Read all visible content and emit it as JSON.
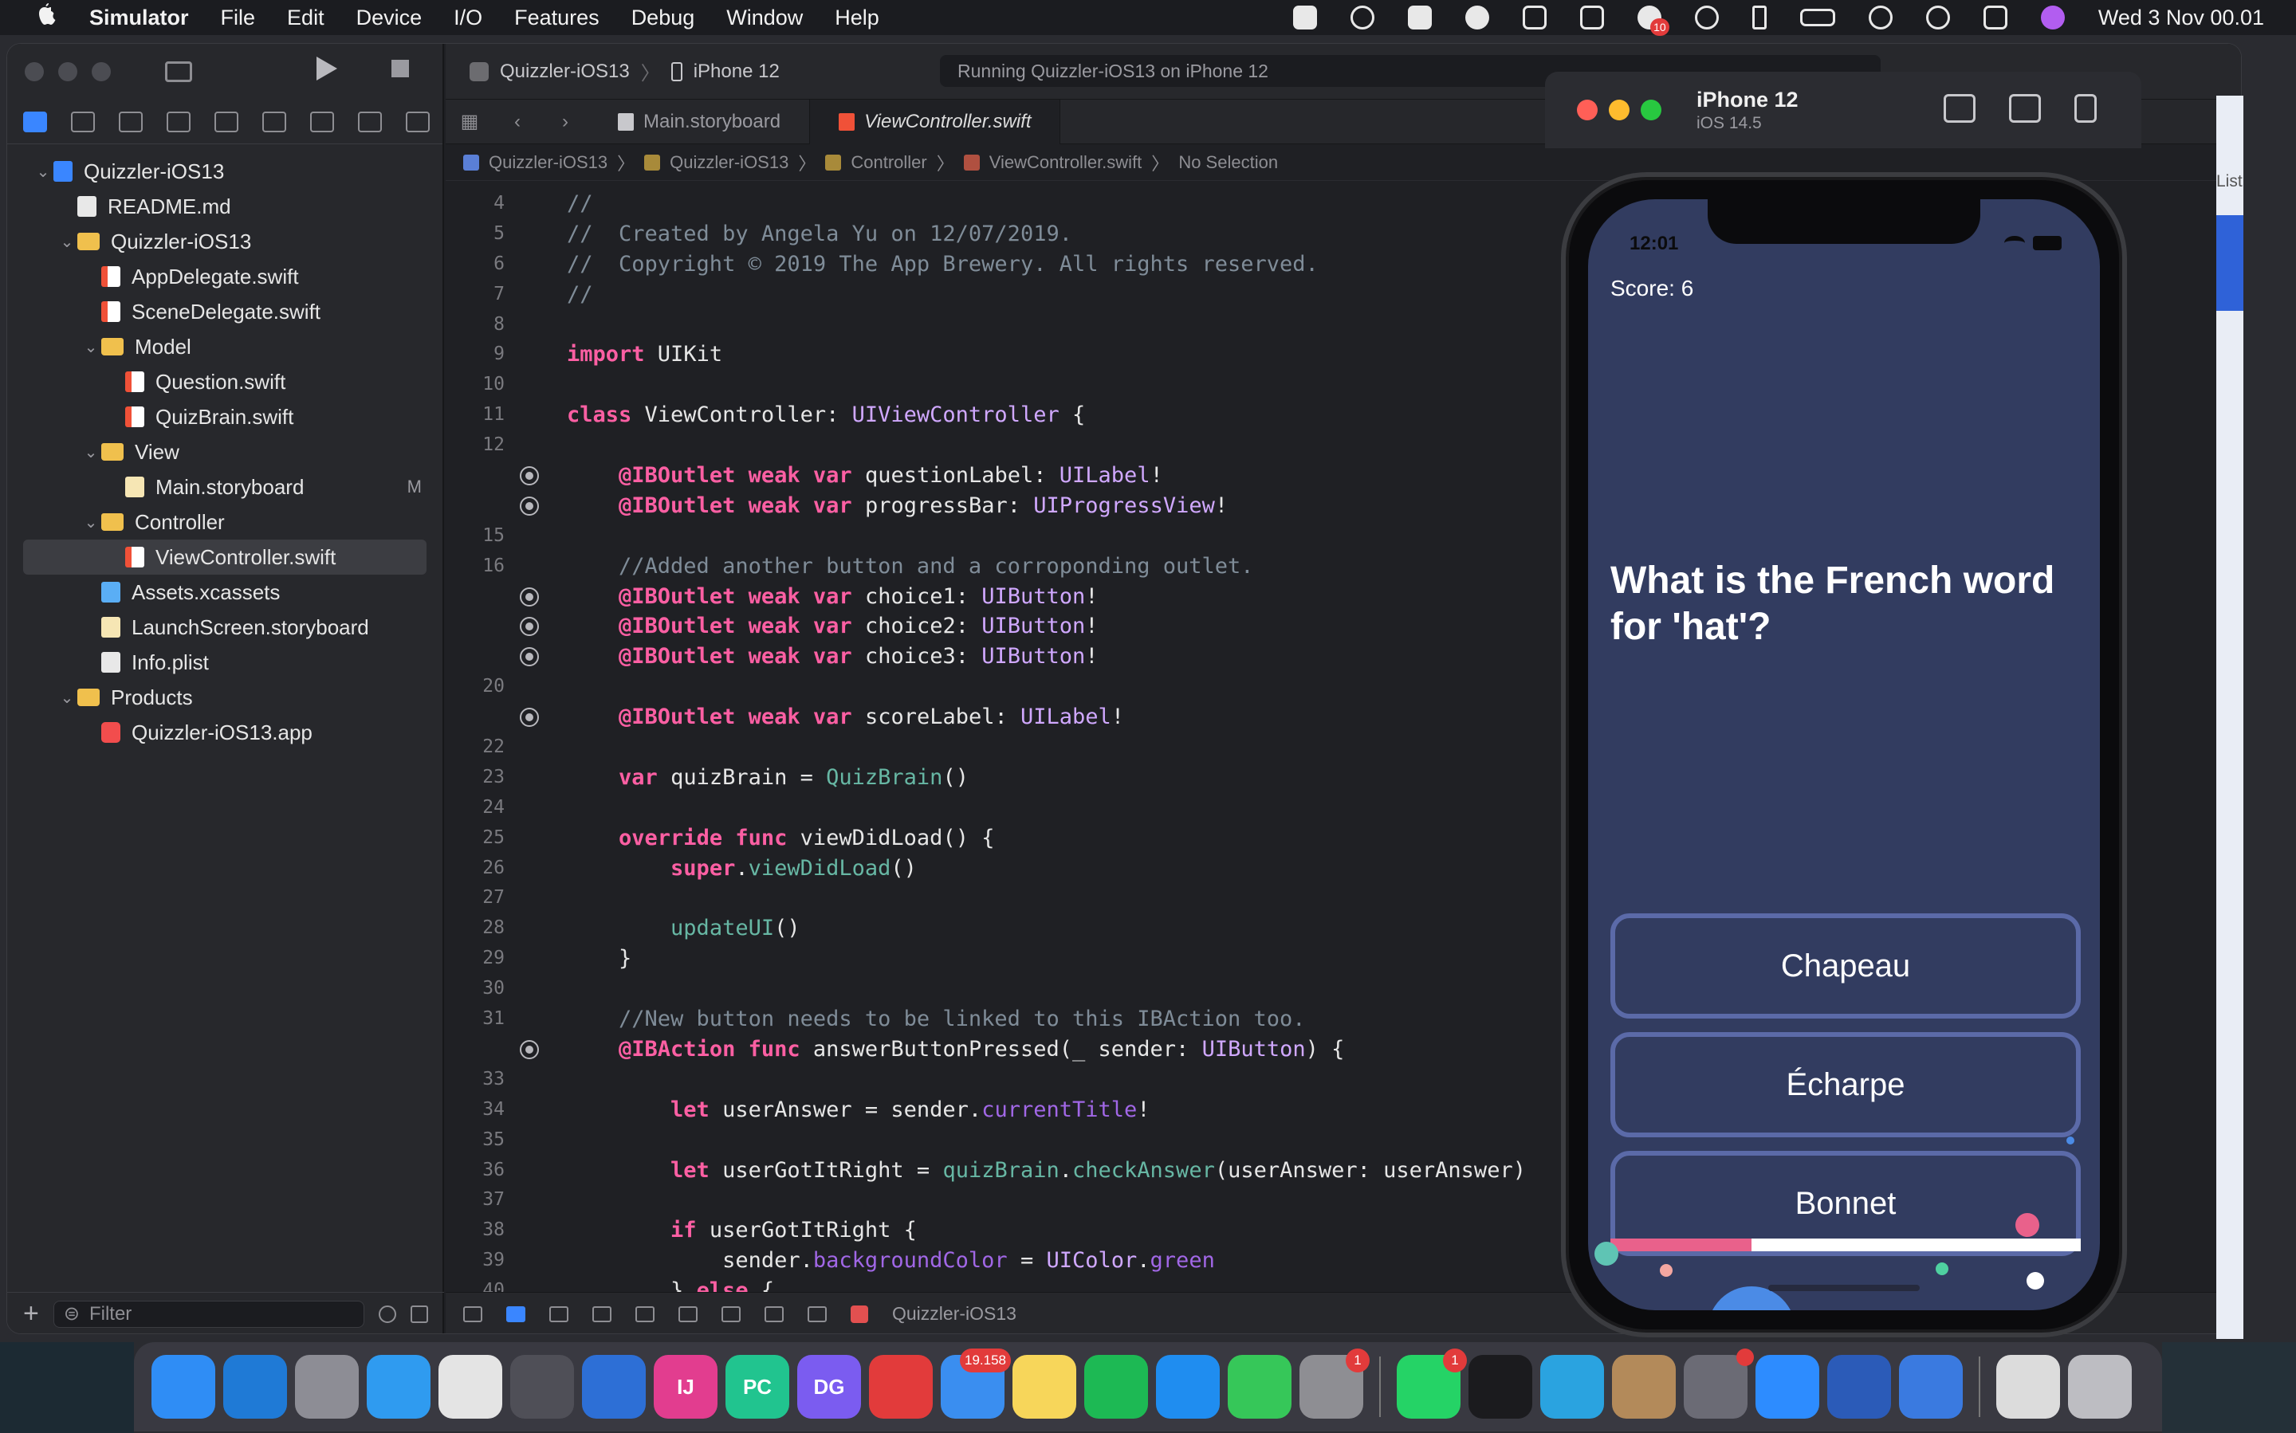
{
  "menubar": {
    "apple_icon": "apple-icon",
    "app_name": "Simulator",
    "items": [
      "File",
      "Edit",
      "Device",
      "I/O",
      "Features",
      "Debug",
      "Window",
      "Help"
    ],
    "status_icons": [
      "screen-record-icon",
      "target-icon",
      "feather-icon",
      "cloud-icon",
      "scribble-icon",
      "dropbox-icon",
      "notification-icon",
      "play-circle-icon",
      "bluetooth-icon",
      "battery-icon",
      "wifi-icon",
      "search-icon",
      "control-center-icon",
      "siri-icon"
    ],
    "notification_badge": "10",
    "clock": "Wed 3 Nov  00.01"
  },
  "xcode": {
    "scheme": "Quizzler-iOS13",
    "device": "iPhone 12",
    "activity": "Running Quizzler-iOS13 on iPhone 12",
    "tabs": [
      {
        "label": "Main.storyboard",
        "active": false
      },
      {
        "label": "ViewController.swift",
        "active": true
      }
    ],
    "jumpbar": [
      "Quizzler-iOS13",
      "Quizzler-iOS13",
      "Controller",
      "ViewController.swift",
      "No Selection"
    ],
    "navigator": [
      {
        "label": "Quizzler-iOS13",
        "icon": "proj",
        "indent": 0,
        "chevron": "open"
      },
      {
        "label": "README.md",
        "icon": "doc",
        "indent": 1,
        "chevron": ""
      },
      {
        "label": "Quizzler-iOS13",
        "icon": "folder",
        "indent": 1,
        "chevron": "open"
      },
      {
        "label": "AppDelegate.swift",
        "icon": "swift",
        "indent": 2,
        "chevron": ""
      },
      {
        "label": "SceneDelegate.swift",
        "icon": "swift",
        "indent": 2,
        "chevron": ""
      },
      {
        "label": "Model",
        "icon": "folder",
        "indent": 2,
        "chevron": "open"
      },
      {
        "label": "Question.swift",
        "icon": "swift",
        "indent": 3,
        "chevron": ""
      },
      {
        "label": "QuizBrain.swift",
        "icon": "swift",
        "indent": 3,
        "chevron": ""
      },
      {
        "label": "View",
        "icon": "folder",
        "indent": 2,
        "chevron": "open"
      },
      {
        "label": "Main.storyboard",
        "icon": "sb",
        "indent": 3,
        "chevron": "",
        "mark": "M"
      },
      {
        "label": "Controller",
        "icon": "folder",
        "indent": 2,
        "chevron": "open"
      },
      {
        "label": "ViewController.swift",
        "icon": "swift",
        "indent": 3,
        "chevron": "",
        "selected": true
      },
      {
        "label": "Assets.xcassets",
        "icon": "assets",
        "indent": 2,
        "chevron": ""
      },
      {
        "label": "LaunchScreen.storyboard",
        "icon": "sb",
        "indent": 2,
        "chevron": ""
      },
      {
        "label": "Info.plist",
        "icon": "doc",
        "indent": 2,
        "chevron": ""
      },
      {
        "label": "Products",
        "icon": "folder",
        "indent": 1,
        "chevron": "open"
      },
      {
        "label": "Quizzler-iOS13.app",
        "icon": "app",
        "indent": 2,
        "chevron": ""
      }
    ],
    "filter_placeholder": "Filter",
    "bottom_scheme": "Quizzler-iOS13",
    "inspector_label": "List",
    "code_lines": [
      {
        "n": "4",
        "bp": false,
        "parts": [
          [
            "c",
            "//"
          ]
        ]
      },
      {
        "n": "5",
        "bp": false,
        "parts": [
          [
            "c",
            "//  Created by Angela Yu on 12/07/2019."
          ]
        ]
      },
      {
        "n": "6",
        "bp": false,
        "parts": [
          [
            "c",
            "//  Copyright © 2019 The App Brewery. All rights reserved."
          ]
        ]
      },
      {
        "n": "7",
        "bp": false,
        "parts": [
          [
            "c",
            "//"
          ]
        ]
      },
      {
        "n": "8",
        "bp": false,
        "parts": []
      },
      {
        "n": "9",
        "bp": false,
        "parts": [
          [
            "k",
            "import"
          ],
          [
            "v",
            " UIKit"
          ]
        ]
      },
      {
        "n": "10",
        "bp": false,
        "parts": []
      },
      {
        "n": "11",
        "bp": false,
        "parts": [
          [
            "k",
            "class"
          ],
          [
            "v",
            " ViewController: "
          ],
          [
            "t",
            "UIViewController"
          ],
          [
            "v",
            " {"
          ]
        ]
      },
      {
        "n": "12",
        "bp": false,
        "parts": []
      },
      {
        "n": "",
        "bp": true,
        "parts": [
          [
            "v",
            "    "
          ],
          [
            "k",
            "@IBOutlet"
          ],
          [
            "v",
            " "
          ],
          [
            "k",
            "weak"
          ],
          [
            "v",
            " "
          ],
          [
            "k",
            "var"
          ],
          [
            "v",
            " questionLabel: "
          ],
          [
            "t",
            "UILabel"
          ],
          [
            "v",
            "!"
          ]
        ]
      },
      {
        "n": "",
        "bp": true,
        "parts": [
          [
            "v",
            "    "
          ],
          [
            "k",
            "@IBOutlet"
          ],
          [
            "v",
            " "
          ],
          [
            "k",
            "weak"
          ],
          [
            "v",
            " "
          ],
          [
            "k",
            "var"
          ],
          [
            "v",
            " progressBar: "
          ],
          [
            "t",
            "UIProgressView"
          ],
          [
            "v",
            "!"
          ]
        ]
      },
      {
        "n": "15",
        "bp": false,
        "parts": []
      },
      {
        "n": "16",
        "bp": false,
        "parts": [
          [
            "c",
            "    //Added another button and a corroponding outlet."
          ]
        ]
      },
      {
        "n": "",
        "bp": true,
        "parts": [
          [
            "v",
            "    "
          ],
          [
            "k",
            "@IBOutlet"
          ],
          [
            "v",
            " "
          ],
          [
            "k",
            "weak"
          ],
          [
            "v",
            " "
          ],
          [
            "k",
            "var"
          ],
          [
            "v",
            " choice1: "
          ],
          [
            "t",
            "UIButton"
          ],
          [
            "v",
            "!"
          ]
        ]
      },
      {
        "n": "",
        "bp": true,
        "parts": [
          [
            "v",
            "    "
          ],
          [
            "k",
            "@IBOutlet"
          ],
          [
            "v",
            " "
          ],
          [
            "k",
            "weak"
          ],
          [
            "v",
            " "
          ],
          [
            "k",
            "var"
          ],
          [
            "v",
            " choice2: "
          ],
          [
            "t",
            "UIButton"
          ],
          [
            "v",
            "!"
          ]
        ]
      },
      {
        "n": "",
        "bp": true,
        "parts": [
          [
            "v",
            "    "
          ],
          [
            "k",
            "@IBOutlet"
          ],
          [
            "v",
            " "
          ],
          [
            "k",
            "weak"
          ],
          [
            "v",
            " "
          ],
          [
            "k",
            "var"
          ],
          [
            "v",
            " choice3: "
          ],
          [
            "t",
            "UIButton"
          ],
          [
            "v",
            "!"
          ]
        ]
      },
      {
        "n": "20",
        "bp": false,
        "parts": []
      },
      {
        "n": "",
        "bp": true,
        "parts": [
          [
            "v",
            "    "
          ],
          [
            "k",
            "@IBOutlet"
          ],
          [
            "v",
            " "
          ],
          [
            "k",
            "weak"
          ],
          [
            "v",
            " "
          ],
          [
            "k",
            "var"
          ],
          [
            "v",
            " scoreLabel: "
          ],
          [
            "t",
            "UILabel"
          ],
          [
            "v",
            "!"
          ]
        ]
      },
      {
        "n": "22",
        "bp": false,
        "parts": []
      },
      {
        "n": "23",
        "bp": false,
        "parts": [
          [
            "v",
            "    "
          ],
          [
            "k",
            "var"
          ],
          [
            "v",
            " quizBrain = "
          ],
          [
            "f",
            "QuizBrain"
          ],
          [
            "v",
            "()"
          ]
        ]
      },
      {
        "n": "24",
        "bp": false,
        "parts": []
      },
      {
        "n": "25",
        "bp": false,
        "parts": [
          [
            "v",
            "    "
          ],
          [
            "k",
            "override"
          ],
          [
            "v",
            " "
          ],
          [
            "k",
            "func"
          ],
          [
            "v",
            " viewDidLoad() {"
          ]
        ]
      },
      {
        "n": "26",
        "bp": false,
        "parts": [
          [
            "v",
            "        "
          ],
          [
            "k",
            "super"
          ],
          [
            "v",
            "."
          ],
          [
            "f",
            "viewDidLoad"
          ],
          [
            "v",
            "()"
          ]
        ]
      },
      {
        "n": "27",
        "bp": false,
        "parts": []
      },
      {
        "n": "28",
        "bp": false,
        "parts": [
          [
            "v",
            "        "
          ],
          [
            "f",
            "updateUI"
          ],
          [
            "v",
            "()"
          ]
        ]
      },
      {
        "n": "29",
        "bp": false,
        "parts": [
          [
            "v",
            "    }"
          ]
        ]
      },
      {
        "n": "30",
        "bp": false,
        "parts": []
      },
      {
        "n": "31",
        "bp": false,
        "parts": [
          [
            "c",
            "    //New button needs to be linked to this IBAction too."
          ]
        ]
      },
      {
        "n": "",
        "bp": true,
        "parts": [
          [
            "v",
            "    "
          ],
          [
            "k",
            "@IBAction"
          ],
          [
            "v",
            " "
          ],
          [
            "k",
            "func"
          ],
          [
            "v",
            " answerButtonPressed(_ sender: "
          ],
          [
            "t",
            "UIButton"
          ],
          [
            "v",
            ") {"
          ]
        ]
      },
      {
        "n": "33",
        "bp": false,
        "parts": []
      },
      {
        "n": "34",
        "bp": false,
        "parts": [
          [
            "v",
            "        "
          ],
          [
            "k",
            "let"
          ],
          [
            "v",
            " userAnswer = sender."
          ],
          [
            "m",
            "currentTitle"
          ],
          [
            "v",
            "!"
          ]
        ]
      },
      {
        "n": "35",
        "bp": false,
        "parts": []
      },
      {
        "n": "36",
        "bp": false,
        "parts": [
          [
            "v",
            "        "
          ],
          [
            "k",
            "let"
          ],
          [
            "v",
            " userGotItRight = "
          ],
          [
            "f",
            "quizBrain"
          ],
          [
            "v",
            "."
          ],
          [
            "f",
            "checkAnswer"
          ],
          [
            "v",
            "(userAnswer: userAnswer)"
          ]
        ]
      },
      {
        "n": "37",
        "bp": false,
        "parts": []
      },
      {
        "n": "38",
        "bp": false,
        "parts": [
          [
            "v",
            "        "
          ],
          [
            "k",
            "if"
          ],
          [
            "v",
            " userGotItRight {"
          ]
        ]
      },
      {
        "n": "39",
        "bp": false,
        "parts": [
          [
            "v",
            "            sender."
          ],
          [
            "m",
            "backgroundColor"
          ],
          [
            "v",
            " = "
          ],
          [
            "t",
            "UIColor"
          ],
          [
            "v",
            "."
          ],
          [
            "m",
            "green"
          ]
        ]
      },
      {
        "n": "40",
        "bp": false,
        "parts": [
          [
            "v",
            "        } "
          ],
          [
            "k",
            "else"
          ],
          [
            "v",
            " {"
          ]
        ]
      }
    ]
  },
  "simulator": {
    "device_name": "iPhone 12",
    "os_version": "iOS 14.5",
    "tools": [
      "screenshot-icon",
      "home-icon",
      "rotate-icon"
    ],
    "status_time": "12:01",
    "score": "Score: 6",
    "question": "What is the French word for 'hat'?",
    "choices": [
      "Chapeau",
      "Écharpe",
      "Bonnet"
    ],
    "progress": 0.3,
    "colors": {
      "background": "#323c60",
      "button_border": "#5b6aa8",
      "progress_fill": "#e9618b"
    }
  },
  "dock": {
    "apps": [
      {
        "name": "finder-icon",
        "color": "#2f8df5",
        "label": ""
      },
      {
        "name": "vscode-icon",
        "color": "#1f7ad6",
        "label": ""
      },
      {
        "name": "launchpad-icon",
        "color": "#8d8d95",
        "label": ""
      },
      {
        "name": "safari-icon",
        "color": "#2f9bf0",
        "label": ""
      },
      {
        "name": "chrome-icon",
        "color": "#e4e4e4",
        "label": ""
      },
      {
        "name": "git-tool-icon",
        "color": "#4f4f57",
        "label": ""
      },
      {
        "name": "xcode-icon",
        "color": "#2d6fd6",
        "label": ""
      },
      {
        "name": "intellij-icon",
        "color": "#e23d8f",
        "label": "IJ"
      },
      {
        "name": "pycharm-icon",
        "color": "#21c48f",
        "label": "PC"
      },
      {
        "name": "datagrip-icon",
        "color": "#7b5cf0",
        "label": "DG"
      },
      {
        "name": "photo-booth-icon",
        "color": "#e23b3b",
        "label": ""
      },
      {
        "name": "mail-icon",
        "color": "#3a8ef0",
        "label": "",
        "badge": "19.158"
      },
      {
        "name": "notes-icon",
        "color": "#f7d65a",
        "label": ""
      },
      {
        "name": "spotify-icon",
        "color": "#1db954",
        "label": ""
      },
      {
        "name": "app-store-icon",
        "color": "#1f8df0",
        "label": ""
      },
      {
        "name": "messages-icon",
        "color": "#36c759",
        "label": ""
      },
      {
        "name": "system-preferences-icon",
        "color": "#8e8e93",
        "label": "",
        "badge": "1"
      },
      {
        "name": "sep",
        "color": "",
        "label": ""
      },
      {
        "name": "whatsapp-icon",
        "color": "#25d366",
        "label": "",
        "badge": "1"
      },
      {
        "name": "terminal-icon",
        "color": "#1b1b1e",
        "label": ""
      },
      {
        "name": "telegram-icon",
        "color": "#2aa3e0",
        "label": ""
      },
      {
        "name": "contacts-icon",
        "color": "#b38a5a",
        "label": ""
      },
      {
        "name": "sourcetree-icon",
        "color": "#6b6b75",
        "label": "",
        "badge": ""
      },
      {
        "name": "zoom-icon",
        "color": "#2d8cff",
        "label": ""
      },
      {
        "name": "word-icon",
        "color": "#2b5bb8",
        "label": ""
      },
      {
        "name": "simulator-icon",
        "color": "#3a7ae0",
        "label": ""
      },
      {
        "name": "sep",
        "color": "",
        "label": ""
      },
      {
        "name": "documents-icon",
        "color": "#dcdcdc",
        "label": ""
      },
      {
        "name": "trash-icon",
        "color": "#bdbdc2",
        "label": ""
      }
    ]
  }
}
